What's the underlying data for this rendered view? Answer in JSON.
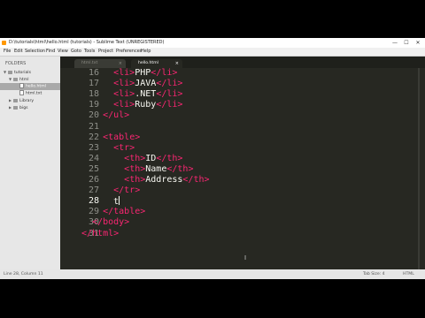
{
  "window": {
    "title": "D:\\tutorials\\html\\hello.html (tutorials) - Sublime Text (UNREGISTERED)",
    "controls": {
      "minimize": "—",
      "maximize": "☐",
      "close": "✕"
    }
  },
  "menu": [
    "File",
    "Edit",
    "Selection",
    "Find",
    "View",
    "Goto",
    "Tools",
    "Project",
    "Preferences",
    "Help"
  ],
  "sidebar": {
    "title": "FOLDERS",
    "root": "tutorials",
    "html_folder": "html",
    "files": [
      "hello.html",
      "html.txt"
    ],
    "other_folders": [
      "Library",
      "bigs"
    ]
  },
  "tabs": [
    {
      "label": "html.txt",
      "close": "×"
    },
    {
      "label": "hello.html",
      "close": "×"
    }
  ],
  "editor": {
    "line_numbers": [
      "16",
      "17",
      "18",
      "19",
      "20",
      "21",
      "22",
      "23",
      "24",
      "25",
      "26",
      "27",
      "28",
      "29",
      "30",
      "31"
    ],
    "current_line": "28",
    "lines": [
      {
        "i": "      ",
        "t1": "<li>",
        "m": "PHP",
        "t2": "</li>"
      },
      {
        "i": "      ",
        "t1": "<li>",
        "m": "JAVA",
        "t2": "</li>"
      },
      {
        "i": "      ",
        "t1": "<li>",
        "m": ".NET",
        "t2": "</li>"
      },
      {
        "i": "      ",
        "t1": "<li>",
        "m": "Ruby",
        "t2": "</li>"
      },
      {
        "i": "    ",
        "t1": "</ul>",
        "m": "",
        "t2": ""
      },
      {
        "i": "",
        "t1": "",
        "m": "",
        "t2": ""
      },
      {
        "i": "    ",
        "t1": "<table>",
        "m": "",
        "t2": ""
      },
      {
        "i": "      ",
        "t1": "<tr>",
        "m": "",
        "t2": ""
      },
      {
        "i": "        ",
        "t1": "<th>",
        "m": "ID",
        "t2": "</th>"
      },
      {
        "i": "        ",
        "t1": "<th>",
        "m": "Name",
        "t2": "</th>"
      },
      {
        "i": "        ",
        "t1": "<th>",
        "m": "Address",
        "t2": "</th>"
      },
      {
        "i": "      ",
        "t1": "</tr>",
        "m": "",
        "t2": ""
      },
      {
        "i": "      ",
        "t1": "",
        "m": "t",
        "t2": ""
      },
      {
        "i": "    ",
        "t1": "</table>",
        "m": "",
        "t2": ""
      },
      {
        "i": "  ",
        "t1": "</body>",
        "m": "",
        "t2": ""
      },
      {
        "i": "",
        "t1": "</html>",
        "m": "",
        "t2": ""
      }
    ]
  },
  "status": {
    "left": "Line 28, Column 11",
    "tab_size": "Tab Size: 4",
    "syntax": "HTML"
  },
  "colors": {
    "tag": "#f92672",
    "text": "#f8f8f2",
    "background": "#272822"
  }
}
